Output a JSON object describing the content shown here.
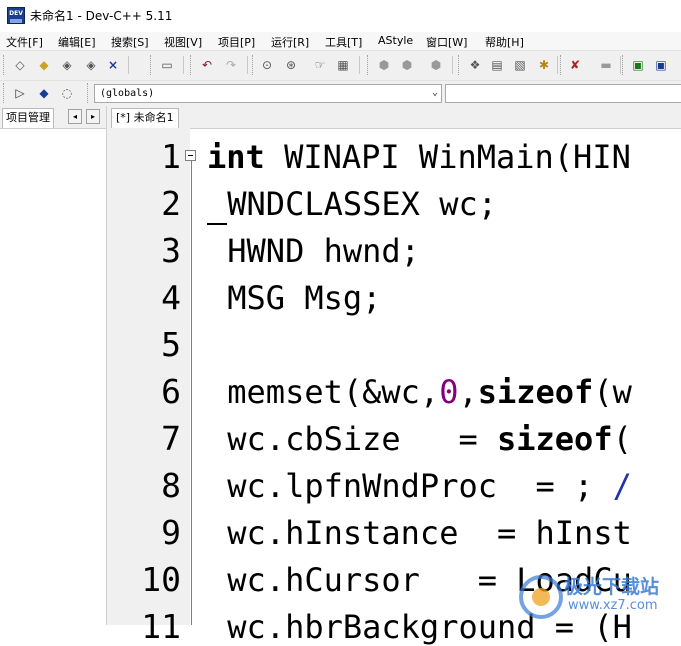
{
  "window": {
    "title": "未命名1 - Dev-C++ 5.11",
    "icon_label": "DEV"
  },
  "menu": {
    "items": [
      "文件[F]",
      "编辑[E]",
      "搜索[S]",
      "视图[V]",
      "项目[P]",
      "运行[R]",
      "工具[T]",
      "AStyle",
      "窗口[W]",
      "帮助[H]"
    ]
  },
  "toolbar": {
    "scope_combo_value": "(globals)"
  },
  "project_panel": {
    "tab_label": "项目管理",
    "scroll_left": "◂",
    "scroll_right": "▸"
  },
  "editor": {
    "tab_label": "[*] 未命名1",
    "line_numbers": [
      "1",
      "2",
      "3",
      "4",
      "5",
      "6",
      "7",
      "8",
      "9",
      "10",
      "11"
    ],
    "lines": [
      [
        {
          "t": "int",
          "c": "kw"
        },
        {
          "t": " WINAPI WinMain(HIN",
          "c": ""
        }
      ],
      [
        {
          "t": " WNDCLASSEX wc;",
          "c": ""
        }
      ],
      [
        {
          "t": " HWND hwnd;",
          "c": ""
        }
      ],
      [
        {
          "t": " MSG Msg;",
          "c": ""
        }
      ],
      [
        {
          "t": "",
          "c": ""
        }
      ],
      [
        {
          "t": " memset(&wc,",
          "c": ""
        },
        {
          "t": "0",
          "c": "num"
        },
        {
          "t": ",",
          "c": ""
        },
        {
          "t": "sizeof",
          "c": "kw"
        },
        {
          "t": "(w",
          "c": ""
        }
      ],
      [
        {
          "t": " wc.cbSize   = ",
          "c": ""
        },
        {
          "t": "sizeof",
          "c": "kw"
        },
        {
          "t": "(",
          "c": ""
        }
      ],
      [
        {
          "t": " wc.lpfnWndProc  = ; ",
          "c": ""
        },
        {
          "t": "/",
          "c": "cmt"
        }
      ],
      [
        {
          "t": " wc.hInstance  = hInst",
          "c": ""
        }
      ],
      [
        {
          "t": " wc.hCursor   = LoadCu",
          "c": ""
        }
      ],
      [
        {
          "t": " wc.hbrBackground = (H",
          "c": ""
        }
      ]
    ]
  },
  "watermark": {
    "line1": "极光下载站",
    "line2": "www.xz7.com"
  },
  "colors": {
    "keyword": "#000000",
    "number": "#800080",
    "comment": "#2233aa",
    "gutter": "#f0f0f0"
  }
}
